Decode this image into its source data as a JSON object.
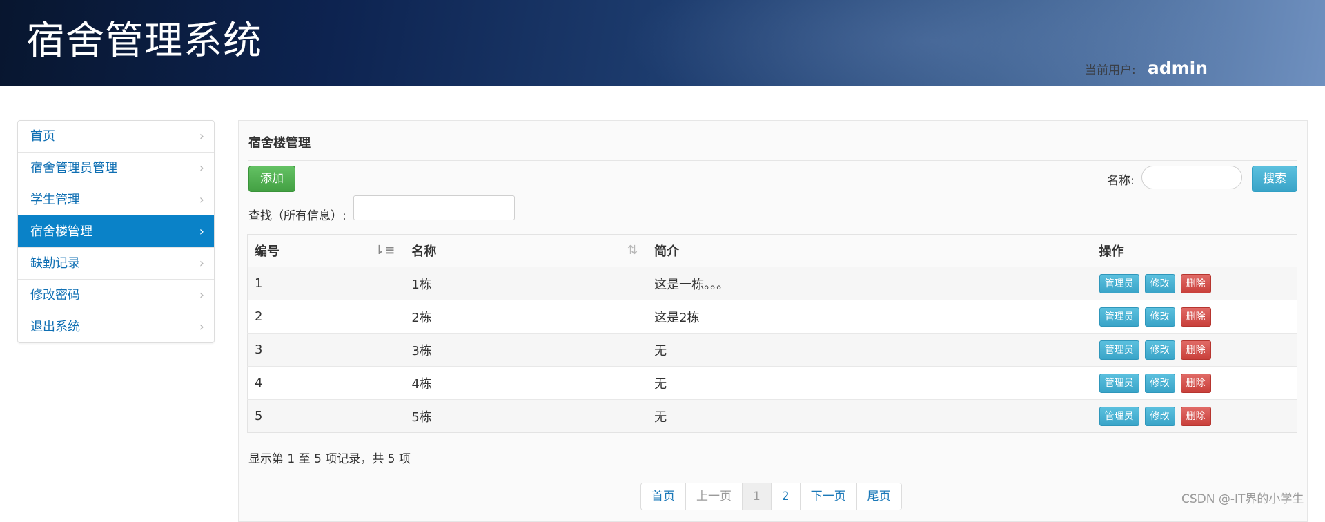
{
  "header": {
    "app_title": "宿舍管理系统",
    "user_label": "当前用户:",
    "user_name": "admin"
  },
  "sidebar": {
    "items": [
      {
        "label": "首页",
        "active": false
      },
      {
        "label": "宿舍管理员管理",
        "active": false
      },
      {
        "label": "学生管理",
        "active": false
      },
      {
        "label": "宿舍楼管理",
        "active": true
      },
      {
        "label": "缺勤记录",
        "active": false
      },
      {
        "label": "修改密码",
        "active": false
      },
      {
        "label": "退出系统",
        "active": false
      }
    ]
  },
  "main": {
    "title": "宿舍楼管理",
    "add_label": "添加",
    "name_label": "名称:",
    "name_input": {
      "value": "",
      "placeholder": ""
    },
    "search_label": "搜索",
    "find_label": "查找（所有信息）:",
    "find_input": {
      "value": "",
      "placeholder": ""
    },
    "table": {
      "headers": [
        "编号",
        "名称",
        "简介",
        "操作"
      ],
      "rows": [
        {
          "id": "1",
          "name": "1栋",
          "desc": "这是一栋。。。"
        },
        {
          "id": "2",
          "name": "2栋",
          "desc": "这是2栋"
        },
        {
          "id": "3",
          "name": "3栋",
          "desc": "无"
        },
        {
          "id": "4",
          "name": "4栋",
          "desc": "无"
        },
        {
          "id": "5",
          "name": "5栋",
          "desc": "无"
        }
      ],
      "row_actions": {
        "admin": "管理员",
        "edit": "修改",
        "delete": "删除"
      }
    },
    "info_text": "显示第 1 至 5 项记录，共 5 项",
    "pagination": {
      "first": "首页",
      "prev": "上一页",
      "pages": [
        "1",
        "2"
      ],
      "current": "1",
      "next": "下一页",
      "last": "尾页"
    }
  },
  "watermark": "CSDN @-IT界的小学生",
  "colors": {
    "active_nav": "#0a82c8",
    "link": "#0f6fb3",
    "add_button": "#4cae4c",
    "info_button": "#46b8da",
    "danger_button": "#d9534f"
  },
  "icons": {
    "nav_chevron": "chevron-right-icon",
    "sort_asc": "sort-asc-icon",
    "sort_both": "sort-both-icon"
  }
}
